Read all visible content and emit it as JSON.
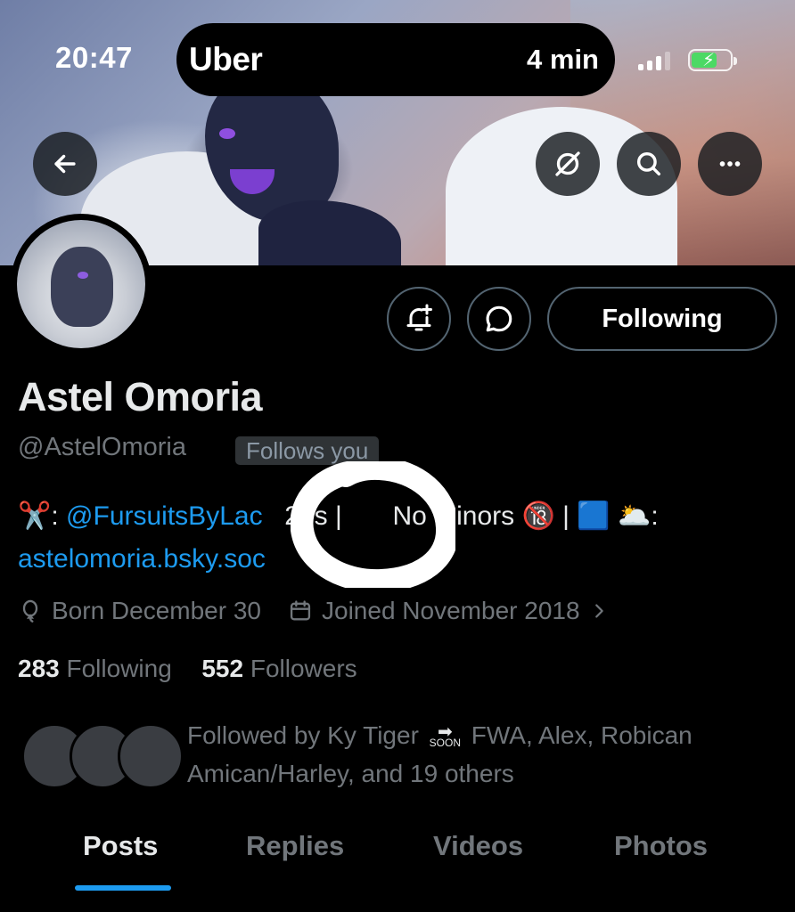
{
  "status_bar": {
    "time": "20:47",
    "live_activity": {
      "app": "Uber",
      "eta": "4 min"
    },
    "battery_charging": true
  },
  "header_actions": {
    "back_icon": "arrow-left-icon",
    "grok_icon": "grok-icon",
    "search_icon": "search-icon",
    "more_icon": "more-horizontal-icon"
  },
  "profile": {
    "display_name": "Astel Omoria",
    "handle": "@AstelOmoria",
    "follows_you_badge": "Follows you",
    "bio": {
      "scissors_emoji": "✂️",
      "colon": ":",
      "mention": "@FursuitsByLac",
      "age": "20s |",
      "no_minors": "No Minors 🔞 |",
      "trailing_emoji": "🟦 🌥️:",
      "link": "astelomoria.bsky.soc"
    },
    "birthday": "Born December 30",
    "joined": "Joined November 2018",
    "following_count": "283",
    "following_label": "Following",
    "followers_count": "552",
    "followers_label": "Followers",
    "followed_by_text_a": "Followed by Ky Tiger",
    "followed_by_soon": "SOON",
    "followed_by_text_b": "FWA, Alex, Robican Amican/Harley, and 19 others"
  },
  "actions": {
    "notify_icon": "bell-plus-icon",
    "message_icon": "message-bubble-icon",
    "following_button": "Following"
  },
  "tabs": [
    {
      "label": "Posts",
      "active": true
    },
    {
      "label": "Replies",
      "active": false
    },
    {
      "label": "Videos",
      "active": false
    },
    {
      "label": "Photos",
      "active": false
    }
  ],
  "colors": {
    "accent": "#1d9bf0",
    "secondary_text": "#71767b",
    "primary_text": "#e7e9ea",
    "background": "#000000"
  }
}
